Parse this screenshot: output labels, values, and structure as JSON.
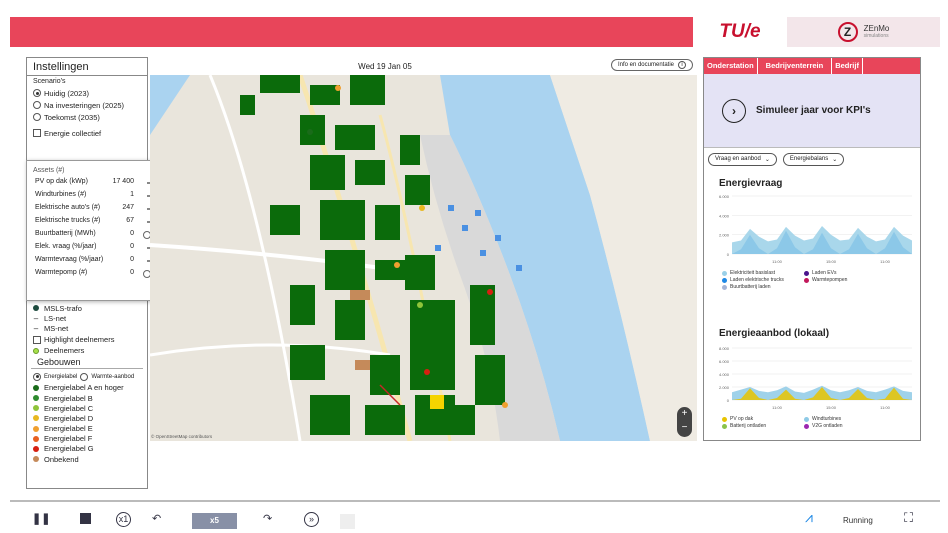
{
  "header": {
    "tue_logo": "TU/e",
    "zenmo_mark": "Z",
    "zenmo_name": "ZEnMo",
    "zenmo_sub": "simulations",
    "accent_color": "#e8455a"
  },
  "settings": {
    "title": "Instellingen",
    "scenarios_label": "Scenario's",
    "scenarios": [
      {
        "label": "Huidig (2023)",
        "selected": true
      },
      {
        "label": "Na investeringen (2025)",
        "selected": false
      },
      {
        "label": "Toekomst (2035)",
        "selected": false
      }
    ],
    "energy_collective": "Energie collectief",
    "legend_grid": [
      {
        "label": "MSLS-trafo",
        "kind": "dot",
        "color": "#1d4a3e"
      },
      {
        "label": "LS-net",
        "kind": "dash"
      },
      {
        "label": "MS-net",
        "kind": "dash"
      }
    ],
    "highlight": "Highlight deelnemers",
    "participants": "Deelnemers",
    "buildings_label": "Gebouwen",
    "building_mode": [
      {
        "label": "Energielabel",
        "selected": true
      },
      {
        "label": "Warmte-aanbod",
        "selected": false
      }
    ],
    "labels": [
      {
        "label": "Energielabel A en hoger",
        "color": "#1a6b1a"
      },
      {
        "label": "Energielabel B",
        "color": "#2e8b2e"
      },
      {
        "label": "Energielabel C",
        "color": "#8fc43a"
      },
      {
        "label": "Energielabel D",
        "color": "#e8b820"
      },
      {
        "label": "Energielabel E",
        "color": "#f0a030"
      },
      {
        "label": "Energielabel F",
        "color": "#e86020"
      },
      {
        "label": "Energielabel G",
        "color": "#d62010"
      },
      {
        "label": "Onbekend",
        "color": "#c58a5a"
      }
    ]
  },
  "assets": {
    "title": "Assets (#)",
    "close_icon": "chevron-left-icon",
    "rows": [
      {
        "label": "PV op dak (kWp)",
        "value": "17 400",
        "level": 0.68
      },
      {
        "label": "Windturbines (#)",
        "value": "1",
        "level": 0.15
      },
      {
        "label": "Elektrische auto's (#)",
        "value": "247",
        "level": 0.42
      },
      {
        "label": "Elektrische trucks (#)",
        "value": "67",
        "level": 0.62
      },
      {
        "label": "Buurtbatterij (MWh)",
        "value": "0",
        "level": 0.0
      },
      {
        "label": "Elek. vraag (%/jaar)",
        "value": "0",
        "level": 0.5
      },
      {
        "label": "Warmtevraag (%/jaar)",
        "value": "0",
        "level": 0.5
      },
      {
        "label": "Warmtepomp (#)",
        "value": "0",
        "level": 0.0
      }
    ]
  },
  "map": {
    "date": "Wed 19 Jan 05",
    "info_button": "Info en documentatie",
    "zoom_in": "+",
    "zoom_out": "−",
    "credit": "© OpenStreetMap contributors"
  },
  "kpi": {
    "tabs": [
      "Onderstation",
      "Bedrijventerrein",
      "Bedrijf"
    ],
    "simulate_label": "Simuleer jaar voor KPI's",
    "dropdown1": "Vraag en aanbod",
    "dropdown2": "Energiebalans",
    "demand_title": "Energievraag",
    "supply_title": "Energieaanbod (lokaal)",
    "demand_legend": [
      {
        "label": "Elektriciteit basislast",
        "color": "#9ad0e8"
      },
      {
        "label": "Laden EVs",
        "color": "#4a148c"
      },
      {
        "label": "Laden elektrische trucks",
        "color": "#1e88e5"
      },
      {
        "label": "Warmtepompen",
        "color": "#c2185b"
      },
      {
        "label": "Buurtbatterij laden",
        "color": "#a5b4d6"
      }
    ],
    "supply_legend": [
      {
        "label": "PV op dak",
        "color": "#e8c400"
      },
      {
        "label": "Windturbines",
        "color": "#8ecae6"
      },
      {
        "label": "Batterij ontladen",
        "color": "#8bc34a"
      },
      {
        "label": "V2G ontladen",
        "color": "#9c27b0"
      }
    ]
  },
  "chart_data": [
    {
      "type": "area",
      "title": "Energievraag",
      "ylim": [
        0,
        6000
      ],
      "yticks": [
        "6.000",
        "4.000",
        "2.000",
        "0"
      ],
      "xticks": [
        "11:00",
        "15:00",
        "11:00"
      ],
      "series": [
        {
          "name": "Elektriciteit basislast",
          "values": [
            1200,
            1400,
            2600,
            1800,
            1300,
            1500,
            2800,
            1900,
            1400,
            1600,
            2900,
            2000,
            1400,
            1500,
            2700,
            1800,
            1300,
            1500,
            2800,
            1900,
            1400
          ]
        },
        {
          "name": "Laden elektrische trucks",
          "values": [
            0,
            500,
            2000,
            600,
            0,
            600,
            2400,
            700,
            0,
            500,
            2200,
            600,
            0,
            500,
            2100,
            600,
            0,
            600,
            2300,
            700,
            0
          ]
        }
      ]
    },
    {
      "type": "area",
      "title": "Energieaanbod (lokaal)",
      "ylim": [
        0,
        8000
      ],
      "yticks": [
        "8.000",
        "6.000",
        "4.000",
        "2.000",
        "0"
      ],
      "xticks": [
        "11:00",
        "15:00",
        "11:00"
      ],
      "series": [
        {
          "name": "PV op dak",
          "values": [
            0,
            200,
            1800,
            300,
            0,
            300,
            1600,
            200,
            0,
            400,
            2000,
            300,
            0,
            300,
            1700,
            300,
            0,
            200,
            1900,
            200,
            0
          ]
        },
        {
          "name": "Windturbines",
          "values": [
            1200,
            1600,
            2000,
            1400,
            1200,
            1500,
            2100,
            1300,
            1100,
            1600,
            2200,
            1500,
            1200,
            1500,
            2000,
            1400,
            1200,
            1600,
            2100,
            1400,
            1200
          ]
        }
      ]
    }
  ],
  "controls": {
    "speed": "x5",
    "status": "Running"
  }
}
